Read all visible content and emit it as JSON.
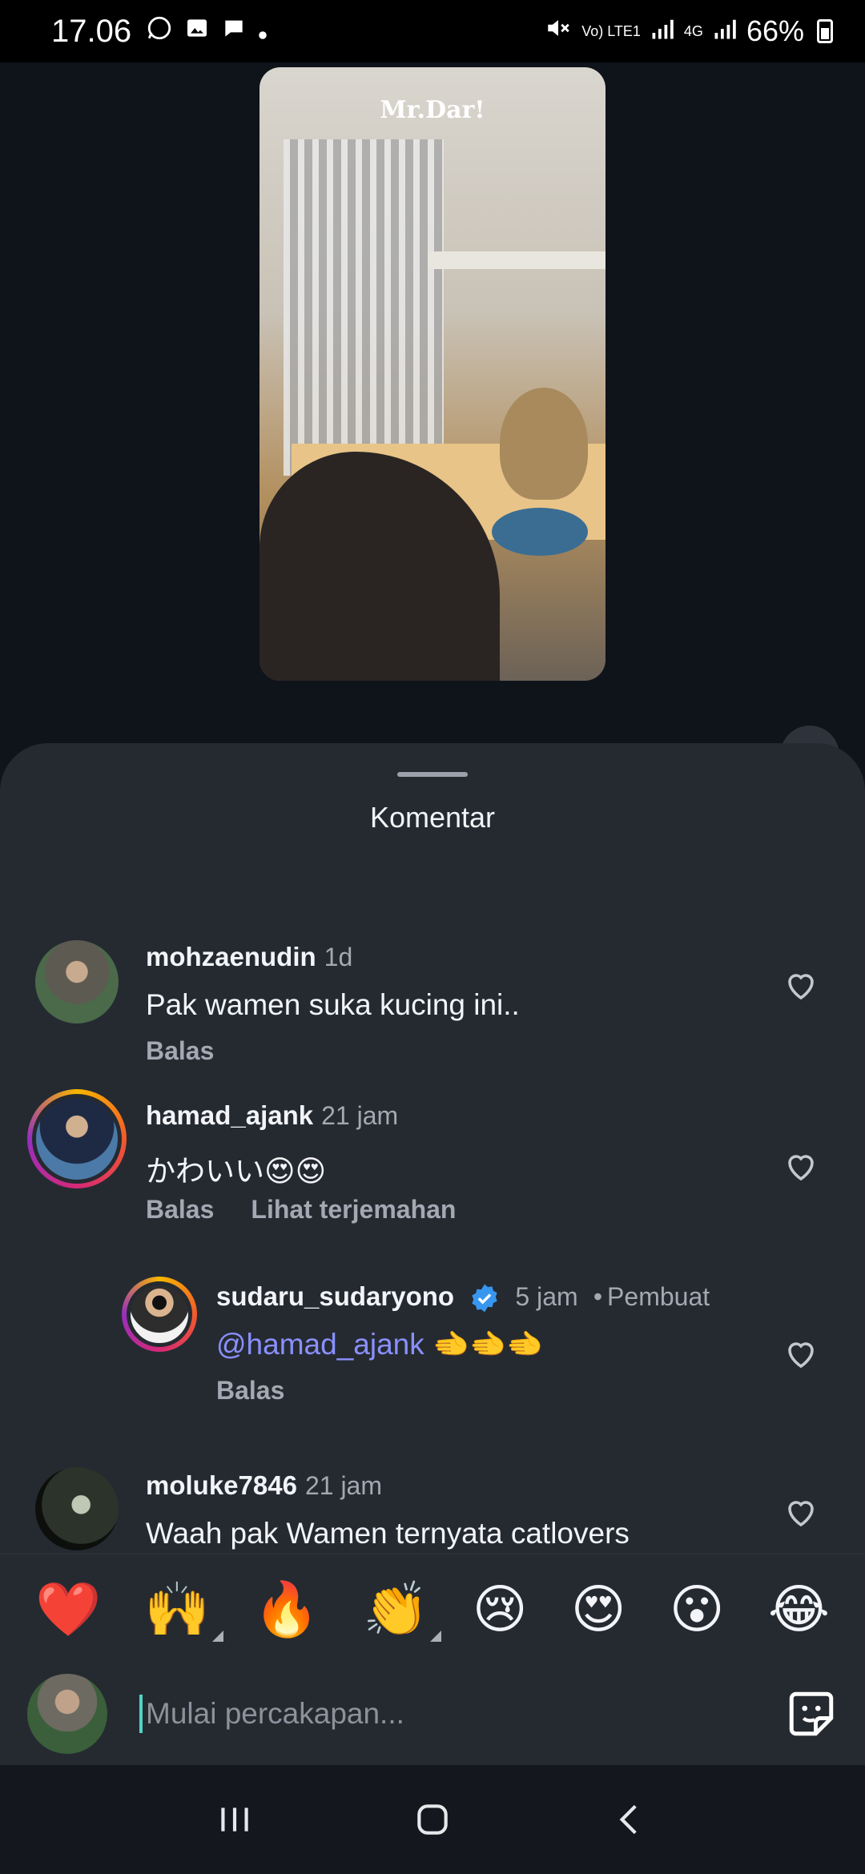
{
  "status_bar": {
    "time": "17.06",
    "battery": "66%",
    "network_labels": [
      "Vo) LTE1",
      "4G"
    ]
  },
  "video": {
    "watermark": "Mr.Dar!",
    "mute_icon": "speaker-icon"
  },
  "comments_sheet": {
    "title": "Komentar",
    "comments": [
      {
        "username": "mohzaenudin",
        "time": "1d",
        "text": "Pak wamen suka kucing ini..",
        "actions": [
          "Balas"
        ]
      },
      {
        "username": "hamad_ajank",
        "time": "21 jam",
        "text": "かわいい😍😍",
        "actions": [
          "Balas",
          "Lihat terjemahan"
        ]
      },
      {
        "username": "sudaru_sudaryono",
        "time": "5 jam",
        "badge": "Pembuat",
        "mention": "@hamad_ajank",
        "text": "🫲🫲🫲",
        "actions": [
          "Balas"
        ]
      },
      {
        "username": "moluke7846",
        "time": "21 jam",
        "text": "Waah pak Wamen ternyata catlovers"
      }
    ]
  },
  "emoji_bar": [
    "❤️",
    "🙌",
    "🔥",
    "👏",
    "😢",
    "😍",
    "😮",
    "😂"
  ],
  "compose": {
    "placeholder": "Mulai percakapan..."
  },
  "colors": {
    "sheet_bg": "#252a31",
    "mention": "#8a90ff",
    "verified": "#3797f0",
    "muted_text": "#a2a9b2"
  }
}
